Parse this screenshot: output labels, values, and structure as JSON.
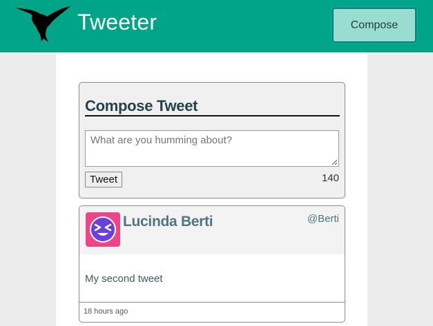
{
  "nav": {
    "logo_icon": "hummingbird-icon",
    "title": "Tweeter",
    "compose_label": "Compose"
  },
  "compose": {
    "heading": "Compose Tweet",
    "placeholder": "What are you humming about?",
    "value": "",
    "tweet_button": "Tweet",
    "counter": "140"
  },
  "tweets": [
    {
      "avatar_icon": "winking-face-avatar-icon",
      "name": "Lucinda Berti",
      "handle": "@Berti",
      "content": "My second tweet",
      "time": "18 hours ago"
    }
  ],
  "colors": {
    "nav_bg": "#00a587",
    "compose_btn_bg": "#99ddd1",
    "avatar_bg": "#ee4488",
    "avatar_face": "#6b3fd9",
    "heading_text": "#24424b",
    "name_text": "#4e7582"
  }
}
